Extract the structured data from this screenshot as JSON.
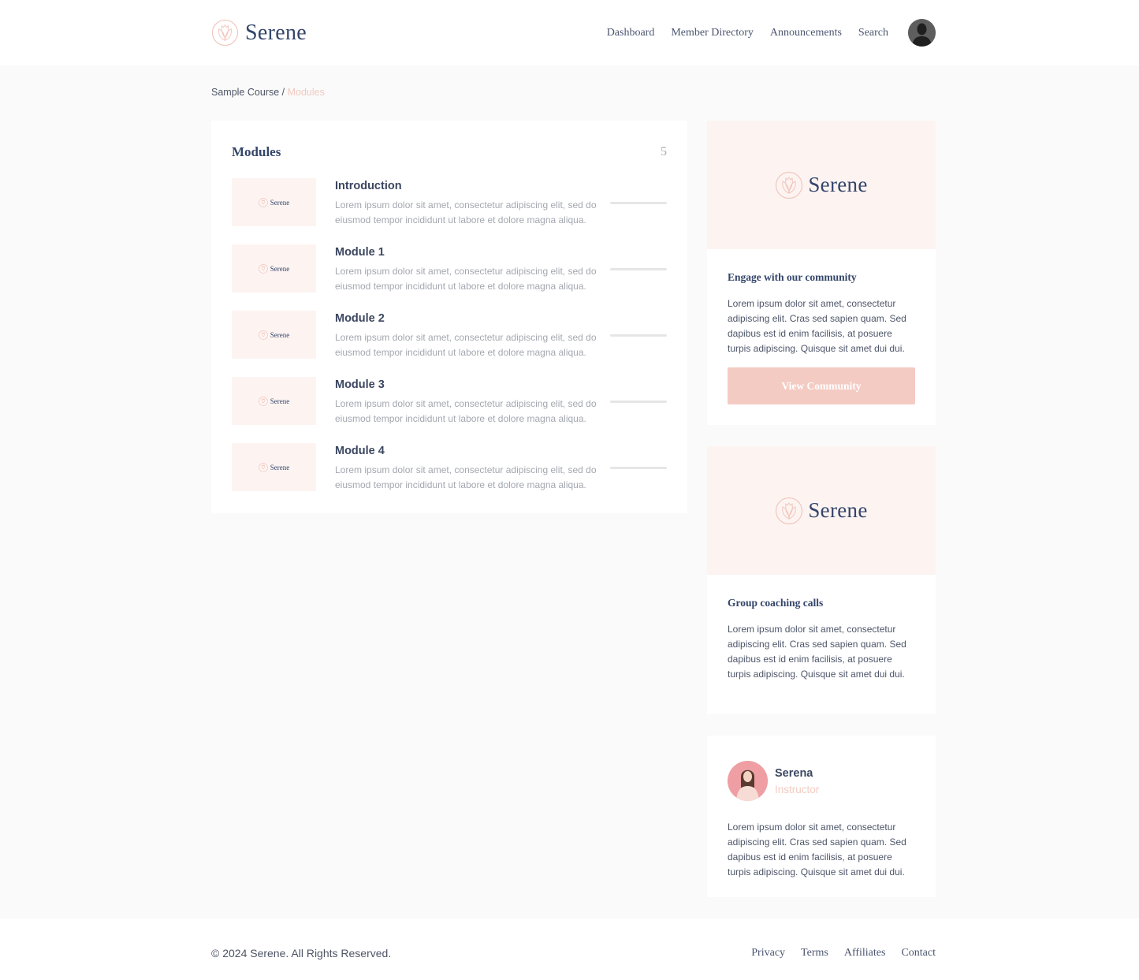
{
  "header": {
    "brand": "Serene",
    "nav": [
      "Dashboard",
      "Member Directory",
      "Announcements",
      "Search"
    ],
    "avatar_icon": "user-avatar-silhouette"
  },
  "breadcrumb": {
    "parent": "Sample Course",
    "separator": " / ",
    "current": "Modules"
  },
  "modules": {
    "title": "Modules",
    "count": "5",
    "thumb_label": "Serene",
    "items": [
      {
        "title": "Introduction",
        "description": "Lorem ipsum dolor sit amet, consectetur adipiscing elit, sed do eiusmod tempor incididunt ut labore et dolore magna aliqua.",
        "progress": 0
      },
      {
        "title": "Module 1",
        "description": "Lorem ipsum dolor sit amet, consectetur adipiscing elit, sed do eiusmod tempor incididunt ut labore et dolore magna aliqua.",
        "progress": 0
      },
      {
        "title": "Module 2",
        "description": "Lorem ipsum dolor sit amet, consectetur adipiscing elit, sed do eiusmod tempor incididunt ut labore et dolore magna aliqua.",
        "progress": 0
      },
      {
        "title": "Module 3",
        "description": "Lorem ipsum dolor sit amet, consectetur adipiscing elit, sed do eiusmod tempor incididunt ut labore et dolore magna aliqua.",
        "progress": 0
      },
      {
        "title": "Module 4",
        "description": "Lorem ipsum dolor sit amet, consectetur adipiscing elit, sed do eiusmod tempor incididunt ut labore et dolore magna aliqua.",
        "progress": 0
      }
    ]
  },
  "sidebar": {
    "community": {
      "banner_brand": "Serene",
      "title": "Engage with our community",
      "text": "Lorem ipsum dolor sit amet, consectetur adipiscing elit. Cras sed sapien quam. Sed dapibus est id enim facilisis, at posuere turpis adipiscing. Quisque sit amet dui dui.",
      "button": "View Community"
    },
    "coaching": {
      "banner_brand": "Serene",
      "title": "Group coaching calls",
      "text": "Lorem ipsum dolor sit amet, consectetur adipiscing elit. Cras sed sapien quam. Sed dapibus est id enim facilisis, at posuere turpis adipiscing. Quisque sit amet dui dui."
    },
    "instructor": {
      "name": "Serena",
      "role": "Instructor",
      "text": "Lorem ipsum dolor sit amet, consectetur adipiscing elit. Cras sed sapien quam. Sed dapibus est id enim facilisis, at posuere turpis adipiscing. Quisque sit amet dui dui."
    }
  },
  "footer": {
    "copyright": "© 2024 Serene. All Rights Reserved.",
    "links": [
      "Privacy",
      "Terms",
      "Affiliates",
      "Contact"
    ]
  },
  "colors": {
    "accent": "#f4cbc3",
    "navy": "#34456a",
    "banner_bg": "#fdf4f2",
    "page_bg": "#fafafa"
  }
}
